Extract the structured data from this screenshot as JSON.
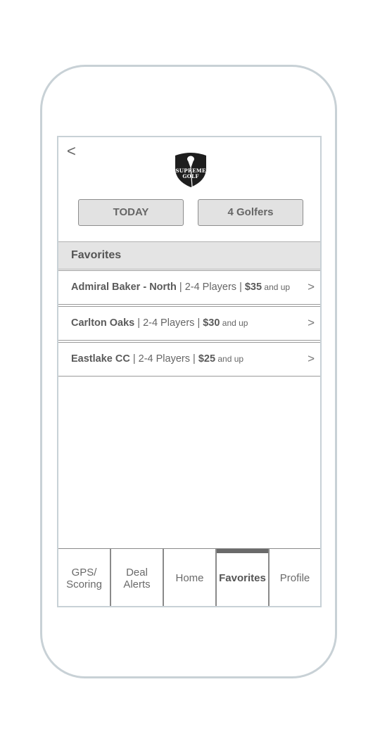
{
  "header": {
    "back_glyph": "<",
    "logo": {
      "line1": "SUPREME",
      "line2": "GOLF",
      "icon": "golf-tee-shield-logo"
    }
  },
  "filters": {
    "date_label": "TODAY",
    "golfers_label": "4 Golfers"
  },
  "favorites": {
    "title": "Favorites",
    "items": [
      {
        "name": "Admiral Baker - North",
        "players": " | 2-4 Players | ",
        "price": "$35",
        "suffix": " and up",
        "chevron": ">"
      },
      {
        "name": "Carlton Oaks",
        "players": " | 2-4 Players | ",
        "price": "$30",
        "suffix": " and up",
        "chevron": ">"
      },
      {
        "name": "Eastlake CC",
        "players": " | 2-4 Players | ",
        "price": "$25",
        "suffix": " and up",
        "chevron": ">"
      }
    ]
  },
  "tabs": {
    "gps_line1": "GPS/",
    "gps_line2": "Scoring",
    "deal_line1": "Deal",
    "deal_line2": "Alerts",
    "home": "Home",
    "favorites": "Favorites",
    "profile": "Profile",
    "active": "Favorites"
  },
  "colors": {
    "frame": "#c8d1d6",
    "header_bg": "#e4e4e4",
    "button_bg": "#e2e2e2",
    "active_tab_indicator": "#6a6a6a",
    "logo_fill": "#1e1e1e"
  }
}
